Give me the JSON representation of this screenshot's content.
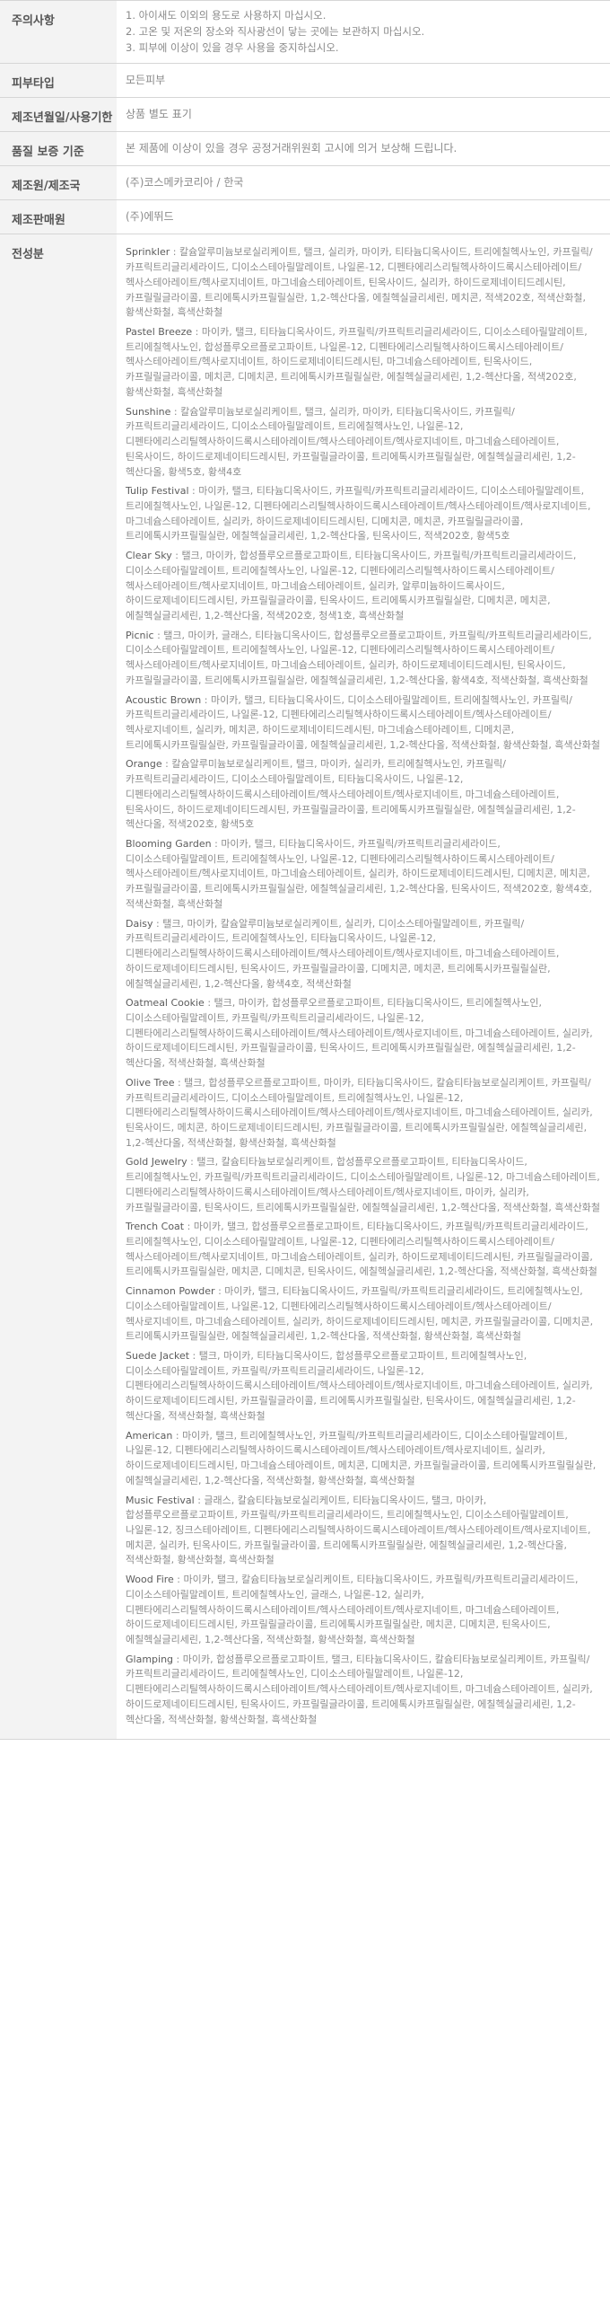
{
  "notice": {
    "label": "주의사항",
    "lines": [
      "1. 아이새도 이외의 용도로 사용하지 마십시오.",
      "2. 고온 및 저온의 장소와 직사광선이 닿는 곳에는 보관하지 마십시오.",
      "3. 피부에 이상이 있을 경우 사용을 중지하십시오."
    ]
  },
  "skin_type": {
    "label": "피부타입",
    "value": "모든피부"
  },
  "expiry": {
    "label": "제조년월일/사용기한",
    "value": "상품 별도 표기"
  },
  "warranty": {
    "label": "품질 보증 기준",
    "value": "본 제품에 이상이 있을 경우 공정거래위원회 고시에 의거 보상해 드립니다."
  },
  "maker": {
    "label": "제조원/제조국",
    "value": "(주)코스메카코리아 / 한국"
  },
  "seller": {
    "label": "제조판매원",
    "value": "(주)에뛰드"
  },
  "ingredients": {
    "label": "전성분",
    "items": [
      {
        "name": "Sprinkler",
        "text": "칼슘알루미늄보로실리케이트, 탤크, 실리카, 마이카, 티타늄디옥사이드, 트리에칠헥사노인, 카프릴릭/카프릭트리글리세라이드, 디이소스테아릴말레이트, 나일론-12, 디펜타에리스리틸헥사하이드록시스테아레이트/헥사스테아레이트/헥사로지네이트, 마그네슘스테아레이트, 틴옥사이드, 실리카, 하이드로제네이티드레시틴, 카프릴릴글라이콜, 트리에톡시카프릴릴실란, 1,2-헥산다올, 에칠헥실글리세린, 메치콘, 적색202호, 적색산화철, 황색산화철, 흑색산화철"
      },
      {
        "name": "Pastel Breeze",
        "text": "마이카, 탤크, 티타늄디옥사이드, 카프릴릭/카프릭트리글리세라이드, 디이소스테아릴말레이트, 트리에칠헥사노인, 합성플루오르플로고파이트, 나일론-12, 디펜타에리스리틸헥사하이드록시스테아레이트/헥사스테아레이트/헥사로지네이트, 하이드로제네이티드레시틴, 마그네슘스테아레이트, 틴옥사이드, 카프릴릴글라이콜, 메치콘, 디메치콘, 트리에톡시카프릴릴실란, 에칠헥실글리세린, 1,2-헥산다올, 적색202호, 황색산화철, 흑색산화철"
      },
      {
        "name": "Sunshine",
        "text": "칼슘알루미늄보로실리케이트, 탤크, 실리카, 마이카, 티타늄디옥사이드, 카프릴릭/카프릭트리글리세라이드, 디이소스테아릴말레이트, 트리에칠헥사노인, 나일론-12, 디펜타에리스리틸헥사하이드록시스테아레이트/헥사스테아레이트/헥사로지네이트, 마그네슘스테아레이트, 틴옥사이드, 하이드로제네이티드레시틴, 카프릴릴글라이콜, 트리에톡시카프릴릴실란, 에칠헥실글리세린, 1,2-헥산다올, 황색5호, 황색4호"
      },
      {
        "name": "Tulip Festival",
        "text": "마이카, 탤크, 티타늄디옥사이드, 카프릴릭/카프릭트리글리세라이드, 디이소스테아릴말레이트, 트리에칠헥사노인, 나일론-12, 디펜타에리스리틸헥사하이드록시스테아레이트/헥사스테아레이트/헥사로지네이트, 마그네슘스테아레이트, 실리카, 하이드로제네이티드레시틴, 디메치콘, 메치콘, 카프릴릴글라이콜, 트리에톡시카프릴릴실란, 에칠헥실글리세린, 1,2-헥산다올, 틴옥사이드, 적색202호, 황색5호"
      },
      {
        "name": "Clear Sky",
        "text": "탤크, 마이카, 합성플루오르플로고파이트, 티타늄디옥사이드, 카프릴릭/카프릭트리글리세라이드, 디이소스테아릴말레이트, 트리에칠헥사노인, 나일론-12, 디펜타에리스리틸헥사하이드록시스테아레이트/헥사스테아레이트/헥사로지네이트, 마그네슘스테아레이트, 실리카, 알루미늄하이드록사이드, 하이드로제네이티드레시틴, 카프릴릴글라이콜, 틴옥사이드, 트리에톡시카프릴릴실란, 디메치콘, 메치콘, 에칠헥실글리세린, 1,2-헥산다올, 적색202호, 청색1호, 흑색산화철"
      },
      {
        "name": "Picnic",
        "text": "탤크, 마이카, 글래스, 티타늄디옥사이드, 합성플루오르플로고파이트, 카프릴릭/카프릭트리글리세라이드, 디이소스테아릴말레이트, 트리에칠헥사노인, 나일론-12, 디펜타에리스리틸헥사하이드록시스테아레이트/헥사스테아레이트/헥사로지네이트, 마그네슘스테아레이트, 실리카, 하이드로제네이티드레시틴, 틴옥사이드, 카프릴릴글라이콜, 트리에톡시카프릴릴실란, 에칠헥실글리세린, 1,2-헥산다올, 황색4호, 적색산화철, 흑색산화철"
      },
      {
        "name": "Acoustic Brown",
        "text": "마이카, 탤크, 티타늄디옥사이드, 디이소스테아릴말레이트, 트리에칠헥사노인, 카프릴릭/카프릭트리글리세라이드, 나일론-12, 디펜타에리스리틸헥사하이드록시스테아레이트/헥사스테아레이트/헥사로지네이트, 실리카, 메치콘, 하이드로제네이티드레시틴, 마그네슘스테아레이트, 디메치콘, 트리에톡시카프릴릴실란, 카프릴릴글라이콜, 에칠헥실글리세린, 1,2-헥산다올, 적색산화철, 황색산화철, 흑색산화철"
      },
      {
        "name": "Orange",
        "text": "칼슘알루미늄보로실리케이트, 탤크, 마이카, 실리카, 트리에칠헥사노인, 카프릴릭/카프릭트리글리세라이드, 디이소스테아릴말레이트, 티타늄디옥사이드, 나일론-12, 디펜타에리스리틸헥사하이드록시스테아레이트/헥사스테아레이트/헥사로지네이트, 마그네슘스테아레이트, 틴옥사이드, 하이드로제네이티드레시틴, 카프릴릴글라이콜, 트리에톡시카프릴릴실란, 에칠헥실글리세린, 1,2-헥산다올, 적색202호, 황색5호"
      },
      {
        "name": "Blooming Garden",
        "text": "마이카, 탤크, 티타늄디옥사이드, 카프릴릭/카프릭트리글리세라이드, 디이소스테아릴말레이트, 트리에칠헥사노인, 나일론-12, 디펜타에리스리틸헥사하이드록시스테아레이트/헥사스테아레이트/헥사로지네이트, 마그네슘스테아레이트, 실리카, 하이드로제네이티드레시틴, 디메치콘, 메치콘, 카프릴릴글라이콜, 트리에톡시카프릴릴실란, 에칠헥실글리세린, 1,2-헥산다올, 틴옥사이드, 적색202호, 황색4호, 적색산화철, 흑색산화철"
      },
      {
        "name": "Daisy",
        "text": "탤크, 마이카, 칼슘알루미늄보로실리케이트, 실리카, 디이소스테아릴말레이트, 카프릴릭/카프릭트리글리세라이드, 트리에칠헥사노인, 티타늄디옥사이드, 나일론-12, 디펜타에리스리틸헥사하이드록시스테아레이트/헥사스테아레이트/헥사로지네이트, 마그네슘스테아레이트, 하이드로제네이티드레시틴, 틴옥사이드, 카프릴릴글라이콜, 디메치콘, 메치콘, 트리에톡시카프릴릴실란, 에칠헥실글리세린, 1,2-헥산다올, 황색4호, 적색산화철"
      },
      {
        "name": "Oatmeal Cookie",
        "text": "탤크, 마이카, 합성플루오르플로고파이트, 티타늄디옥사이드, 트리에칠헥사노인, 디이소스테아릴말레이트, 카프릴릭/카프릭트리글리세라이드, 나일론-12, 디펜타에리스리틸헥사하이드록시스테아레이트/헥사스테아레이트/헥사로지네이트, 마그네슘스테아레이트, 실리카, 하이드로제네이티드레시틴, 카프릴릴글라이콜, 틴옥사이드, 트리에톡시카프릴릴실란, 에칠헥실글리세린, 1,2-헥산다올, 적색산화철, 흑색산화철"
      },
      {
        "name": "Olive Tree",
        "text": "탤크, 합성플루오르플로고파이트, 마이카, 티타늄디옥사이드, 칼슘티타늄보로실리케이트, 카프릴릭/카프릭트리글리세라이드, 디이소스테아릴말레이트, 트리에칠헥사노인, 나일론-12, 디펜타에리스리틸헥사하이드록시스테아레이트/헥사스테아레이트/헥사로지네이트, 마그네슘스테아레이트, 실리카, 틴옥사이드, 메치콘, 하이드로제네이티드레시틴, 카프릴릴글라이콜, 트리에톡시카프릴릴실란, 에칠헥실글리세린, 1,2-헥산다올, 적색산화철, 황색산화철, 흑색산화철"
      },
      {
        "name": "Gold Jewelry",
        "text": "탤크, 칼슘티타늄보로실리케이트, 합성플루오르플로고파이트, 티타늄디옥사이드, 트리에칠헥사노인, 카프릴릭/카프릭트리글리세라이드, 디이소스테아릴말레이트, 나일론-12, 마그네슘스테아레이트, 디펜타에리스리틸헥사하이드록시스테아레이트/헥사스테아레이트/헥사로지네이트, 마이카, 실리카, 카프릴릴글라이콜, 틴옥사이드, 트리에톡시카프릴릴실란, 에칠헥실글리세린, 1,2-헥산다올, 적색산화철, 흑색산화철"
      },
      {
        "name": "Trench Coat",
        "text": "마이카, 탤크, 합성플루오르플로고파이트, 티타늄디옥사이드, 카프릴릭/카프릭트리글리세라이드, 트리에칠헥사노인, 디이소스테아릴말레이트, 나일론-12, 디펜타에리스리틸헥사하이드록시스테아레이트/헥사스테아레이트/헥사로지네이트, 마그네슘스테아레이트, 실리카, 하이드로제네이티드레시틴, 카프릴릴글라이콜, 트리에톡시카프릴릴실란, 메치콘, 디메치콘, 틴옥사이드, 에칠헥실글리세린, 1,2-헥산다올, 적색산화철, 흑색산화철"
      },
      {
        "name": "Cinnamon Powder",
        "text": "마이카, 탤크, 티타늄디옥사이드, 카프릴릭/카프릭트리글리세라이드, 트리에칠헥사노인, 디이소스테아릴말레이트, 나일론-12, 디펜타에리스리틸헥사하이드록시스테아레이트/헥사스테아레이트/헥사로지네이트, 마그네슘스테아레이트, 실리카, 하이드로제네이티드레시틴, 메치콘, 카프릴릴글라이콜, 디메치콘, 트리에톡시카프릴릴실란, 에칠헥실글리세린, 1,2-헥산다올, 적색산화철, 황색산화철, 흑색산화철"
      },
      {
        "name": "Suede Jacket",
        "text": "탤크, 마이카, 티타늄디옥사이드, 합성플루오르플로고파이트, 트리에칠헥사노인, 디이소스테아릴말레이트, 카프릴릭/카프릭트리글리세라이드, 나일론-12, 디펜타에리스리틸헥사하이드록시스테아레이트/헥사스테아레이트/헥사로지네이트, 마그네슘스테아레이트, 실리카, 하이드로제네이티드레시틴, 카프릴릴글라이콜, 트리에톡시카프릴릴실란, 틴옥사이드, 에칠헥실글리세린, 1,2-헥산다올, 적색산화철, 흑색산화철"
      },
      {
        "name": "American",
        "text": "마이카, 탤크, 트리에칠헥사노인, 카프릴릭/카프릭트리글리세라이드, 디이소스테아릴말레이트, 나일론-12, 디펜타에리스리틸헥사하이드록시스테아레이트/헥사스테아레이트/헥사로지네이트, 실리카, 하이드로제네이티드레시틴, 마그네슘스테아레이트, 메치콘, 디메치콘, 카프릴릴글라이콜, 트리에톡시카프릴릴실란, 에칠헥실글리세린, 1,2-헥산다올, 적색산화철, 황색산화철, 흑색산화철"
      },
      {
        "name": "Music Festival",
        "text": "글래스, 칼슘티타늄보로실리케이트, 티타늄디옥사이드, 탤크, 마이카, 합성플루오르플로고파이트, 카프릴릭/카프릭트리글리세라이드, 트리에칠헥사노인, 디이소스테아릴말레이트, 나일론-12, 징크스테아레이트, 디펜타에리스리틸헥사하이드록시스테아레이트/헥사스테아레이트/헥사로지네이트, 메치콘, 실리카, 틴옥사이드, 카프릴릴글라이콜, 트리에톡시카프릴릴실란, 에칠헥실글리세린, 1,2-헥산다올, 적색산화철, 황색산화철, 흑색산화철"
      },
      {
        "name": "Wood Fire",
        "text": "마이카, 탤크, 칼슘티타늄보로실리케이트, 티타늄디옥사이드, 카프릴릭/카프릭트리글리세라이드, 디이소스테아릴말레이트, 트리에칠헥사노인, 글래스, 나일론-12, 실리카, 디펜타에리스리틸헥사하이드록시스테아레이트/헥사스테아레이트/헥사로지네이트, 마그네슘스테아레이트, 하이드로제네이티드레시틴, 카프릴릴글라이콜, 트리에톡시카프릴릴실란, 메치콘, 디메치콘, 틴옥사이드, 에칠헥실글리세린, 1,2-헥산다올, 적색산화철, 황색산화철, 흑색산화철"
      },
      {
        "name": "Glamping",
        "text": "마이카, 합성플루오르플로고파이트, 탤크, 티타늄디옥사이드, 칼슘티타늄보로실리케이트, 카프릴릭/카프릭트리글리세라이드, 트리에칠헥사노인, 디이소스테아릴말레이트, 나일론-12, 디펜타에리스리틸헥사하이드록시스테아레이트/헥사스테아레이트/헥사로지네이트, 마그네슘스테아레이트, 실리카, 하이드로제네이티드레시틴, 틴옥사이드, 카프릴릴글라이콜, 트리에톡시카프릴릴실란, 에칠헥실글리세린, 1,2-헥산다올, 적색산화철, 황색산화철, 흑색산화철"
      }
    ]
  }
}
